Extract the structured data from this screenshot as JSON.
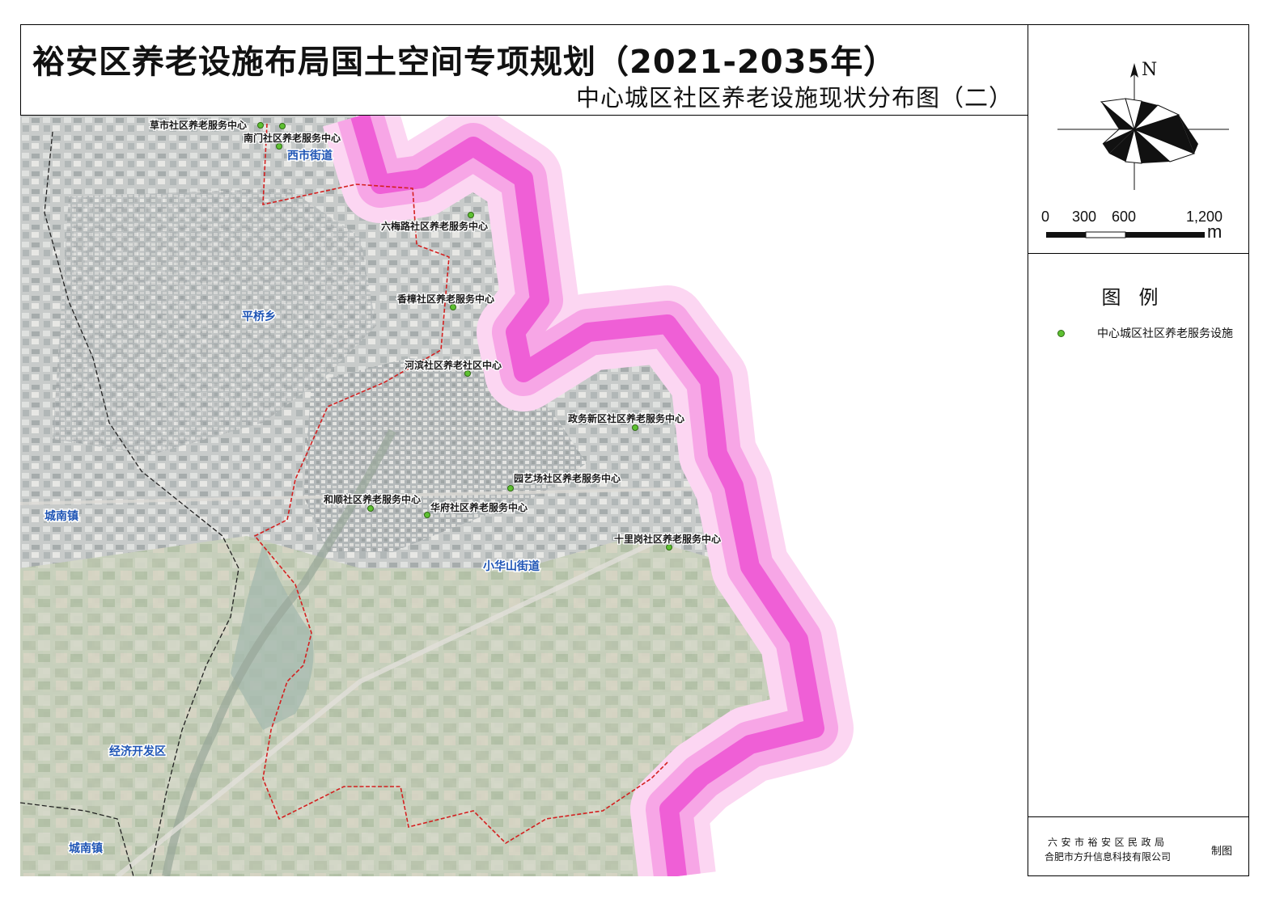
{
  "header": {
    "main_title": "裕安区养老设施布局国土空间专项规划（2021-2035年）",
    "sub_title": "中心城区社区养老设施现状分布图（二）"
  },
  "north_arrow": {
    "letter": "N"
  },
  "scale_bar": {
    "labels": [
      "0",
      "300",
      "600",
      "1,200"
    ],
    "unit": "m"
  },
  "legend": {
    "title": "图例",
    "items": [
      {
        "label": "中心城区社区养老服务设施",
        "color": "#5ec132"
      }
    ]
  },
  "credits": {
    "line1": "六安市裕安区民政局",
    "line2": "合肥市方升信息科技有限公司",
    "line3": "制图"
  },
  "map": {
    "facilities": [
      {
        "label": "草市社区养老服务中心"
      },
      {
        "label": "南门社区养老服务中心"
      },
      {
        "label": "六梅路社区养老服务中心"
      },
      {
        "label": "香樟社区养老服务中心"
      },
      {
        "label": "河滨社区养老社区中心"
      },
      {
        "label": "政务新区社区养老服务中心"
      },
      {
        "label": "园艺场社区养老服务中心"
      },
      {
        "label": "和顺社区养老服务中心"
      },
      {
        "label": "华府社区养老服务中心"
      },
      {
        "label": "十里岗社区养老服务中心"
      }
    ],
    "districts": [
      {
        "label": "西市街道"
      },
      {
        "label": "平桥乡"
      },
      {
        "label": "城南镇"
      },
      {
        "label": "小华山街道"
      },
      {
        "label": "经济开发区"
      },
      {
        "label": "城南镇"
      }
    ],
    "colors": {
      "buffer_outer": "#fcd6f2",
      "buffer_mid": "#f7a6e6",
      "buffer_inner": "#ef5fd6",
      "boundary": "#d42020",
      "facility_dot": "#5ec132"
    }
  }
}
